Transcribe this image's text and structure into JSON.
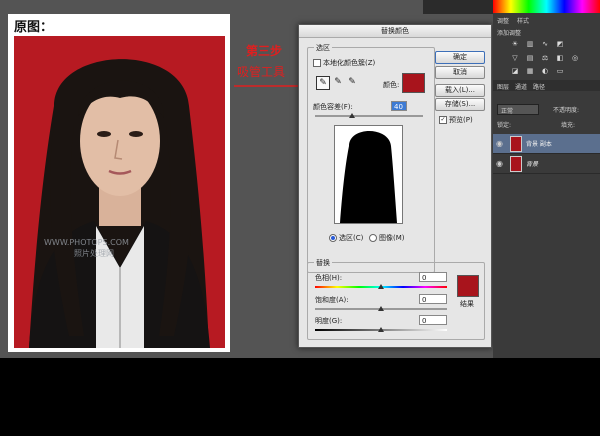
{
  "photo": {
    "title": "原图：",
    "watermark_url": "WWW.PHOTOPS.COM",
    "watermark_cn": "照片处理网"
  },
  "annotation": {
    "step": "第三步",
    "tool_note": "吸管工具"
  },
  "dialog": {
    "title": "替换颜色",
    "selection_legend": "选区",
    "localized_label": "本地化颜色簇(Z)",
    "color_label": "颜色:",
    "fuzziness_label": "颜色容差(F):",
    "fuzziness_value": "40",
    "mode_selection": "选区(C)",
    "mode_image": "图像(M)",
    "replace_legend": "替换",
    "hue_label": "色相(H):",
    "hue_value": "0",
    "saturation_label": "饱和度(A):",
    "saturation_value": "0",
    "lightness_label": "明度(G):",
    "lightness_value": "0",
    "result_label": "结果",
    "buttons": {
      "ok": "确定",
      "cancel": "取消",
      "load": "载入(L)...",
      "save": "存储(S)..."
    },
    "preview_label": "预览(P)",
    "selected_color": "#a8141c",
    "result_color": "#a8141c"
  },
  "panels": {
    "adjust_tab": "调整",
    "style_tab": "样式",
    "adjust_subtitle": "添加调整",
    "layers_tab": "图层",
    "channels_tab": "通道",
    "paths_tab": "路径",
    "blend_mode": "正常",
    "opacity_label": "不透明度:",
    "lock_label": "锁定:",
    "fill_label": "填充:",
    "layers": [
      {
        "name": "背景 副本"
      },
      {
        "name": "背景"
      }
    ]
  }
}
